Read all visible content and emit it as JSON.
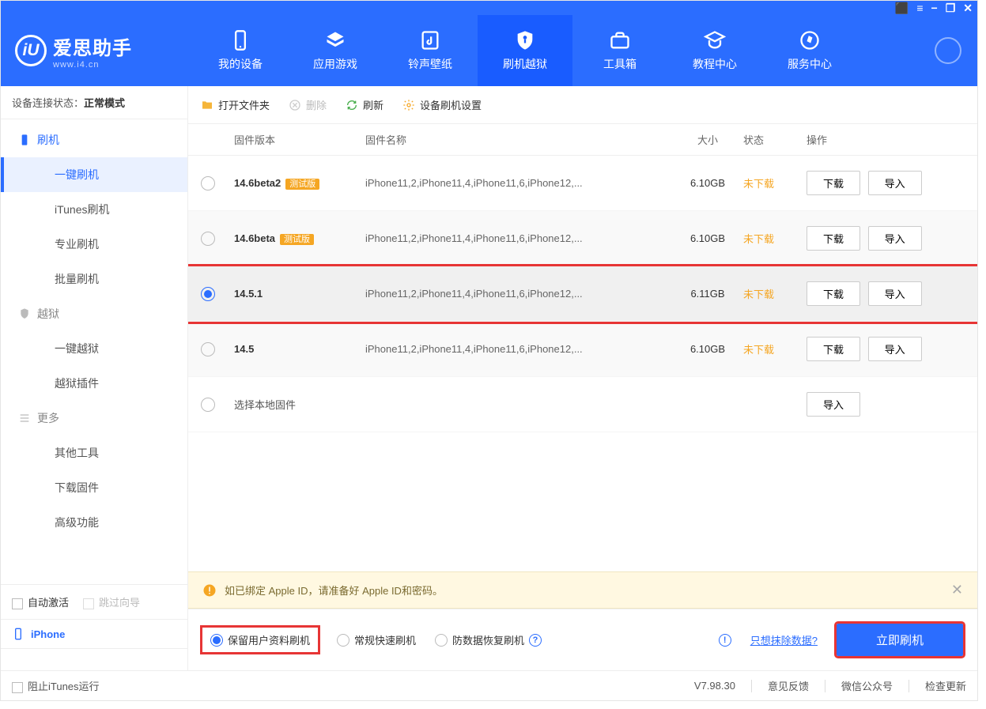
{
  "brand": {
    "name": "爱思助手",
    "url": "www.i4.cn"
  },
  "window_controls": [
    "⬛",
    "≡",
    "−",
    "❐",
    "✕"
  ],
  "nav": [
    {
      "label": "我的设备"
    },
    {
      "label": "应用游戏"
    },
    {
      "label": "铃声壁纸"
    },
    {
      "label": "刷机越狱"
    },
    {
      "label": "工具箱"
    },
    {
      "label": "教程中心"
    },
    {
      "label": "服务中心"
    }
  ],
  "status": {
    "label": "设备连接状态：",
    "value": "正常模式"
  },
  "sidebar": {
    "groups": [
      {
        "label": "刷机",
        "items": [
          "一键刷机",
          "iTunes刷机",
          "专业刷机",
          "批量刷机"
        ]
      },
      {
        "label": "越狱",
        "items": [
          "一键越狱",
          "越狱插件"
        ]
      },
      {
        "label": "更多",
        "items": [
          "其他工具",
          "下载固件",
          "高级功能"
        ]
      }
    ],
    "auto_activate": "自动激活",
    "skip_guide": "跳过向导",
    "device_name": "iPhone"
  },
  "toolbar": {
    "open": "打开文件夹",
    "delete": "删除",
    "refresh": "刷新",
    "settings": "设备刷机设置"
  },
  "columns": {
    "version": "固件版本",
    "name": "固件名称",
    "size": "大小",
    "status": "状态",
    "ops": "操作"
  },
  "badge_text": "测试版",
  "btn_download": "下载",
  "btn_import": "导入",
  "rows": [
    {
      "version": "14.6beta2",
      "badge": true,
      "name": "iPhone11,2,iPhone11,4,iPhone11,6,iPhone12,...",
      "size": "6.10GB",
      "status": "未下载",
      "selected": false
    },
    {
      "version": "14.6beta",
      "badge": true,
      "name": "iPhone11,2,iPhone11,4,iPhone11,6,iPhone12,...",
      "size": "6.10GB",
      "status": "未下载",
      "selected": false
    },
    {
      "version": "14.5.1",
      "badge": false,
      "name": "iPhone11,2,iPhone11,4,iPhone11,6,iPhone12,...",
      "size": "6.11GB",
      "status": "未下载",
      "selected": true
    },
    {
      "version": "14.5",
      "badge": false,
      "name": "iPhone11,2,iPhone11,4,iPhone11,6,iPhone12,...",
      "size": "6.10GB",
      "status": "未下载",
      "selected": false
    }
  ],
  "local_row": "选择本地固件",
  "notice": "如已绑定 Apple ID，请准备好 Apple ID和密码。",
  "options": [
    {
      "label": "保留用户资料刷机",
      "selected": true,
      "hl": true
    },
    {
      "label": "常规快速刷机",
      "selected": false
    },
    {
      "label": "防数据恢复刷机",
      "selected": false,
      "info": true
    }
  ],
  "wipe_link": "只想抹除数据?",
  "flash_btn": "立即刷机",
  "footer": {
    "block_itunes": "阻止iTunes运行",
    "version": "V7.98.30",
    "feedback": "意见反馈",
    "wechat": "微信公众号",
    "check_update": "检查更新"
  }
}
